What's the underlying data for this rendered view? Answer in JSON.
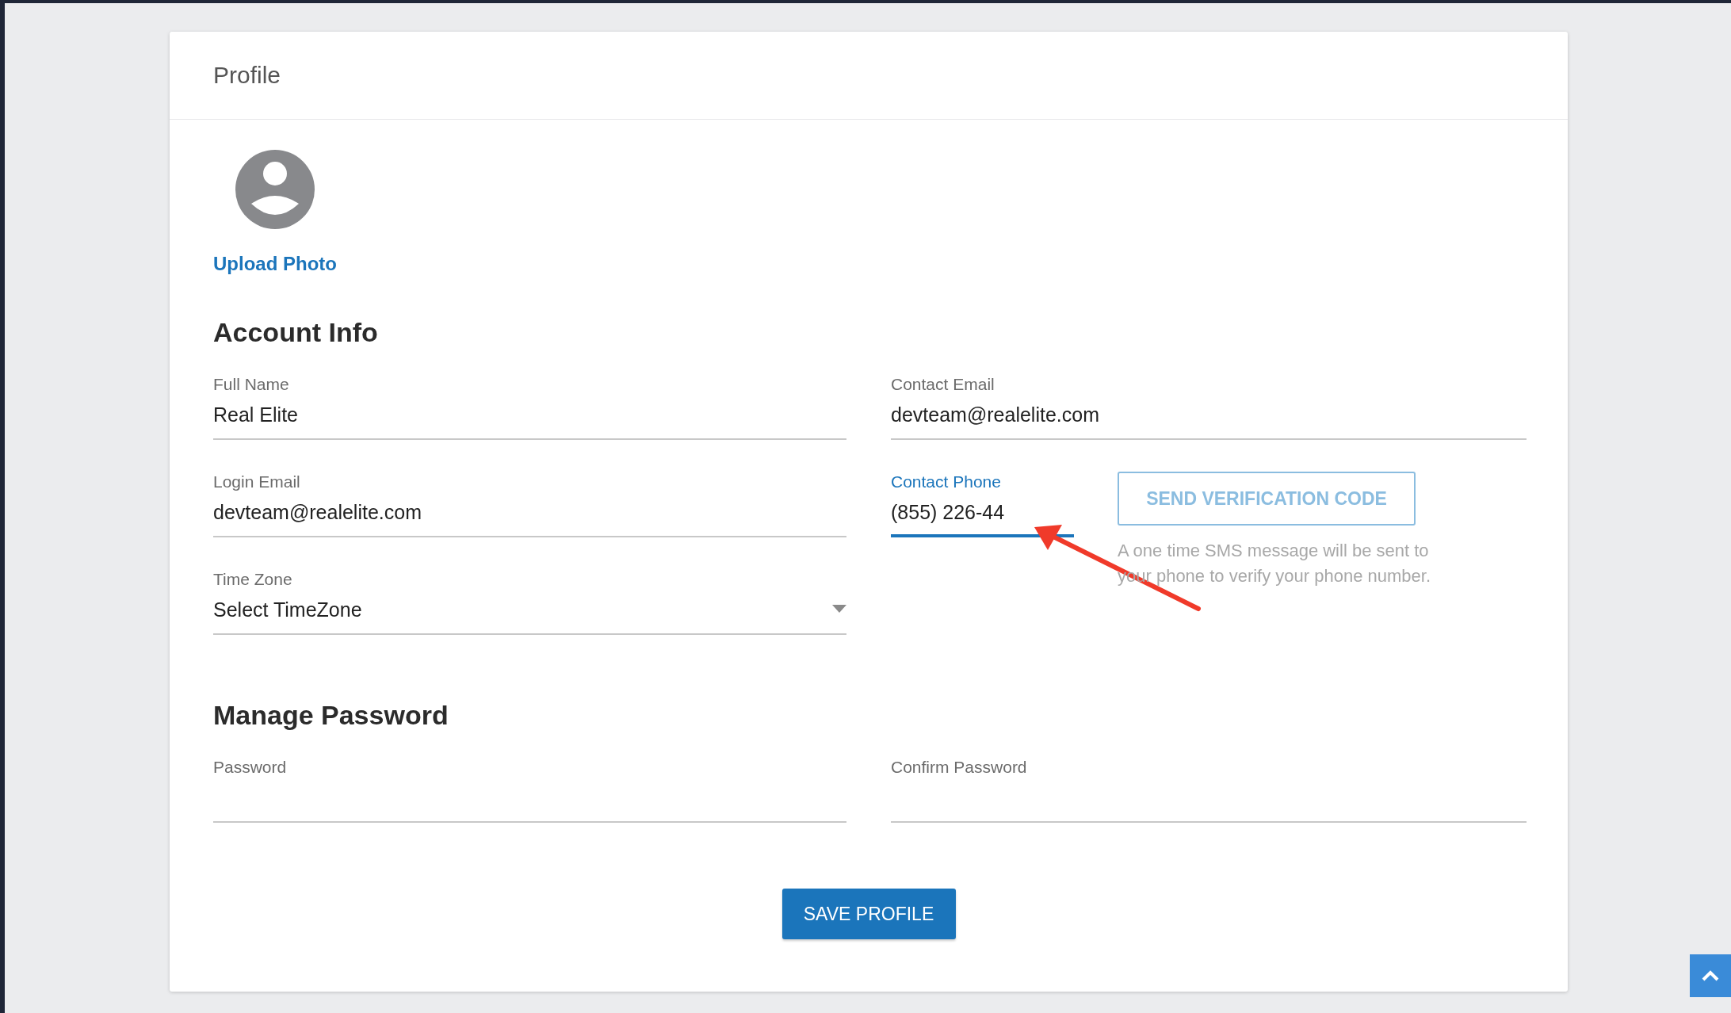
{
  "header": {
    "title": "Profile"
  },
  "photo": {
    "upload_link": "Upload Photo"
  },
  "account_info": {
    "heading": "Account Info",
    "fields": [
      {
        "kind": "text",
        "label": "Full Name",
        "value": "Real Elite",
        "focused": false
      },
      {
        "kind": "text",
        "label": "Contact Email",
        "value": "devteam@realelite.com",
        "focused": false
      },
      {
        "kind": "text",
        "label": "Login Email",
        "value": "devteam@realelite.com",
        "focused": false
      },
      {
        "kind": "phone",
        "label": "Contact Phone",
        "value": "(855) 226-44",
        "focused": true,
        "button": {
          "label": "SEND VERIFICATION CODE",
          "disabled": true
        },
        "help": "A one time SMS message will be sent to your phone to verify your phone number."
      },
      {
        "kind": "select",
        "label": "Time Zone",
        "value": "Select TimeZone",
        "focused": false
      }
    ]
  },
  "manage_password": {
    "heading": "Manage Password",
    "fields": [
      {
        "label": "Password",
        "focused": false
      },
      {
        "label": "Confirm Password",
        "focused": false
      }
    ]
  },
  "save_button": "SAVE PROFILE"
}
